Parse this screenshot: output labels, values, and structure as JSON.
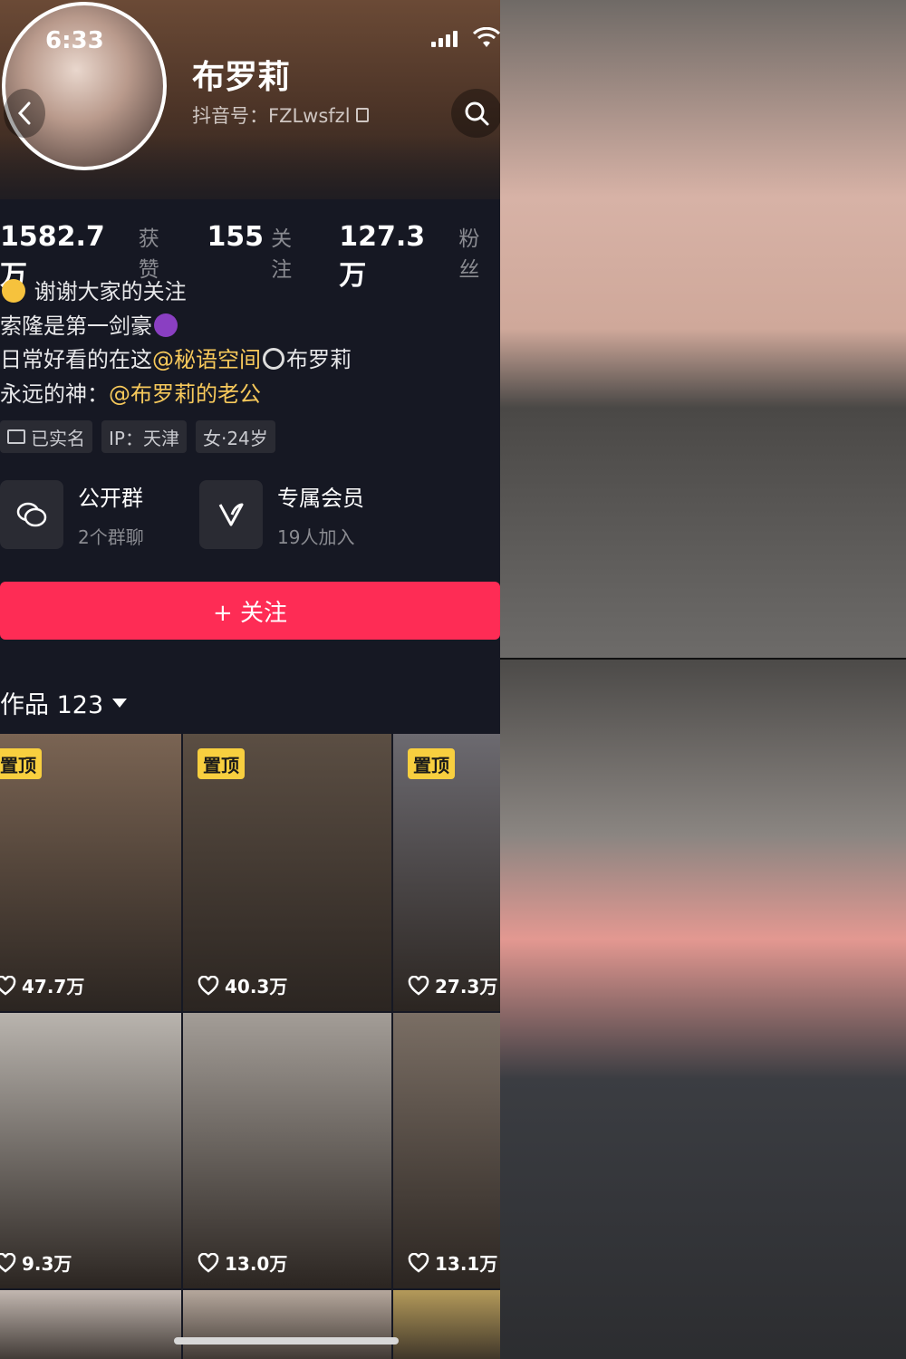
{
  "status": {
    "time": "6:33"
  },
  "profile": {
    "name": "布罗莉",
    "douyin_id": "抖音号：FZLwsfzl"
  },
  "stats": [
    {
      "num": "1582.7万",
      "label": "获赞"
    },
    {
      "num": "155",
      "label": "关注"
    },
    {
      "num": "127.3万",
      "label": "粉丝"
    }
  ],
  "bio": {
    "line1": "谢谢大家的关注",
    "line2": "索隆是第一剑豪",
    "line3_prefix": "日常好看的在这",
    "line3_mention": "@秘语空间",
    "line3_suffix": "布罗莉",
    "line4_prefix": "永远的神：",
    "line4_mention": "@布罗莉的老公"
  },
  "tags": {
    "verified": "已实名",
    "ip": "IP：天津",
    "gender_age": "女·24岁"
  },
  "groups": [
    {
      "title": "公开群",
      "sub": "2个群聊",
      "icon": "chat-bubbles-icon"
    },
    {
      "title": "专属会员",
      "sub": "19人加入",
      "icon": "vip-v-icon"
    }
  ],
  "follow_label": "+ 关注",
  "works": {
    "label": "作品 123"
  },
  "pin_label": "置顶",
  "videos": [
    {
      "likes": "47.7万",
      "pinned": true,
      "color": "#7a6453"
    },
    {
      "likes": "40.3万",
      "pinned": true,
      "color": "#5b4e43"
    },
    {
      "likes": "27.3万",
      "pinned": true,
      "color": "#6c6a70"
    },
    {
      "likes": "9.3万",
      "pinned": false,
      "color": "#b9b4ae"
    },
    {
      "likes": "13.0万",
      "pinned": false,
      "color": "#a39d97"
    },
    {
      "likes": "13.1万",
      "pinned": false,
      "color": "#7a6e64"
    },
    {
      "likes": "",
      "pinned": false,
      "color": "#c2b7b0"
    },
    {
      "likes": "",
      "pinned": false,
      "color": "#b5a79c"
    },
    {
      "likes": "",
      "pinned": false,
      "color": "#b49a5a"
    }
  ],
  "colors": {
    "accent": "#fe2c55",
    "pin": "#f8cf3f",
    "mention": "#f7c95b",
    "bg": "#161823"
  }
}
